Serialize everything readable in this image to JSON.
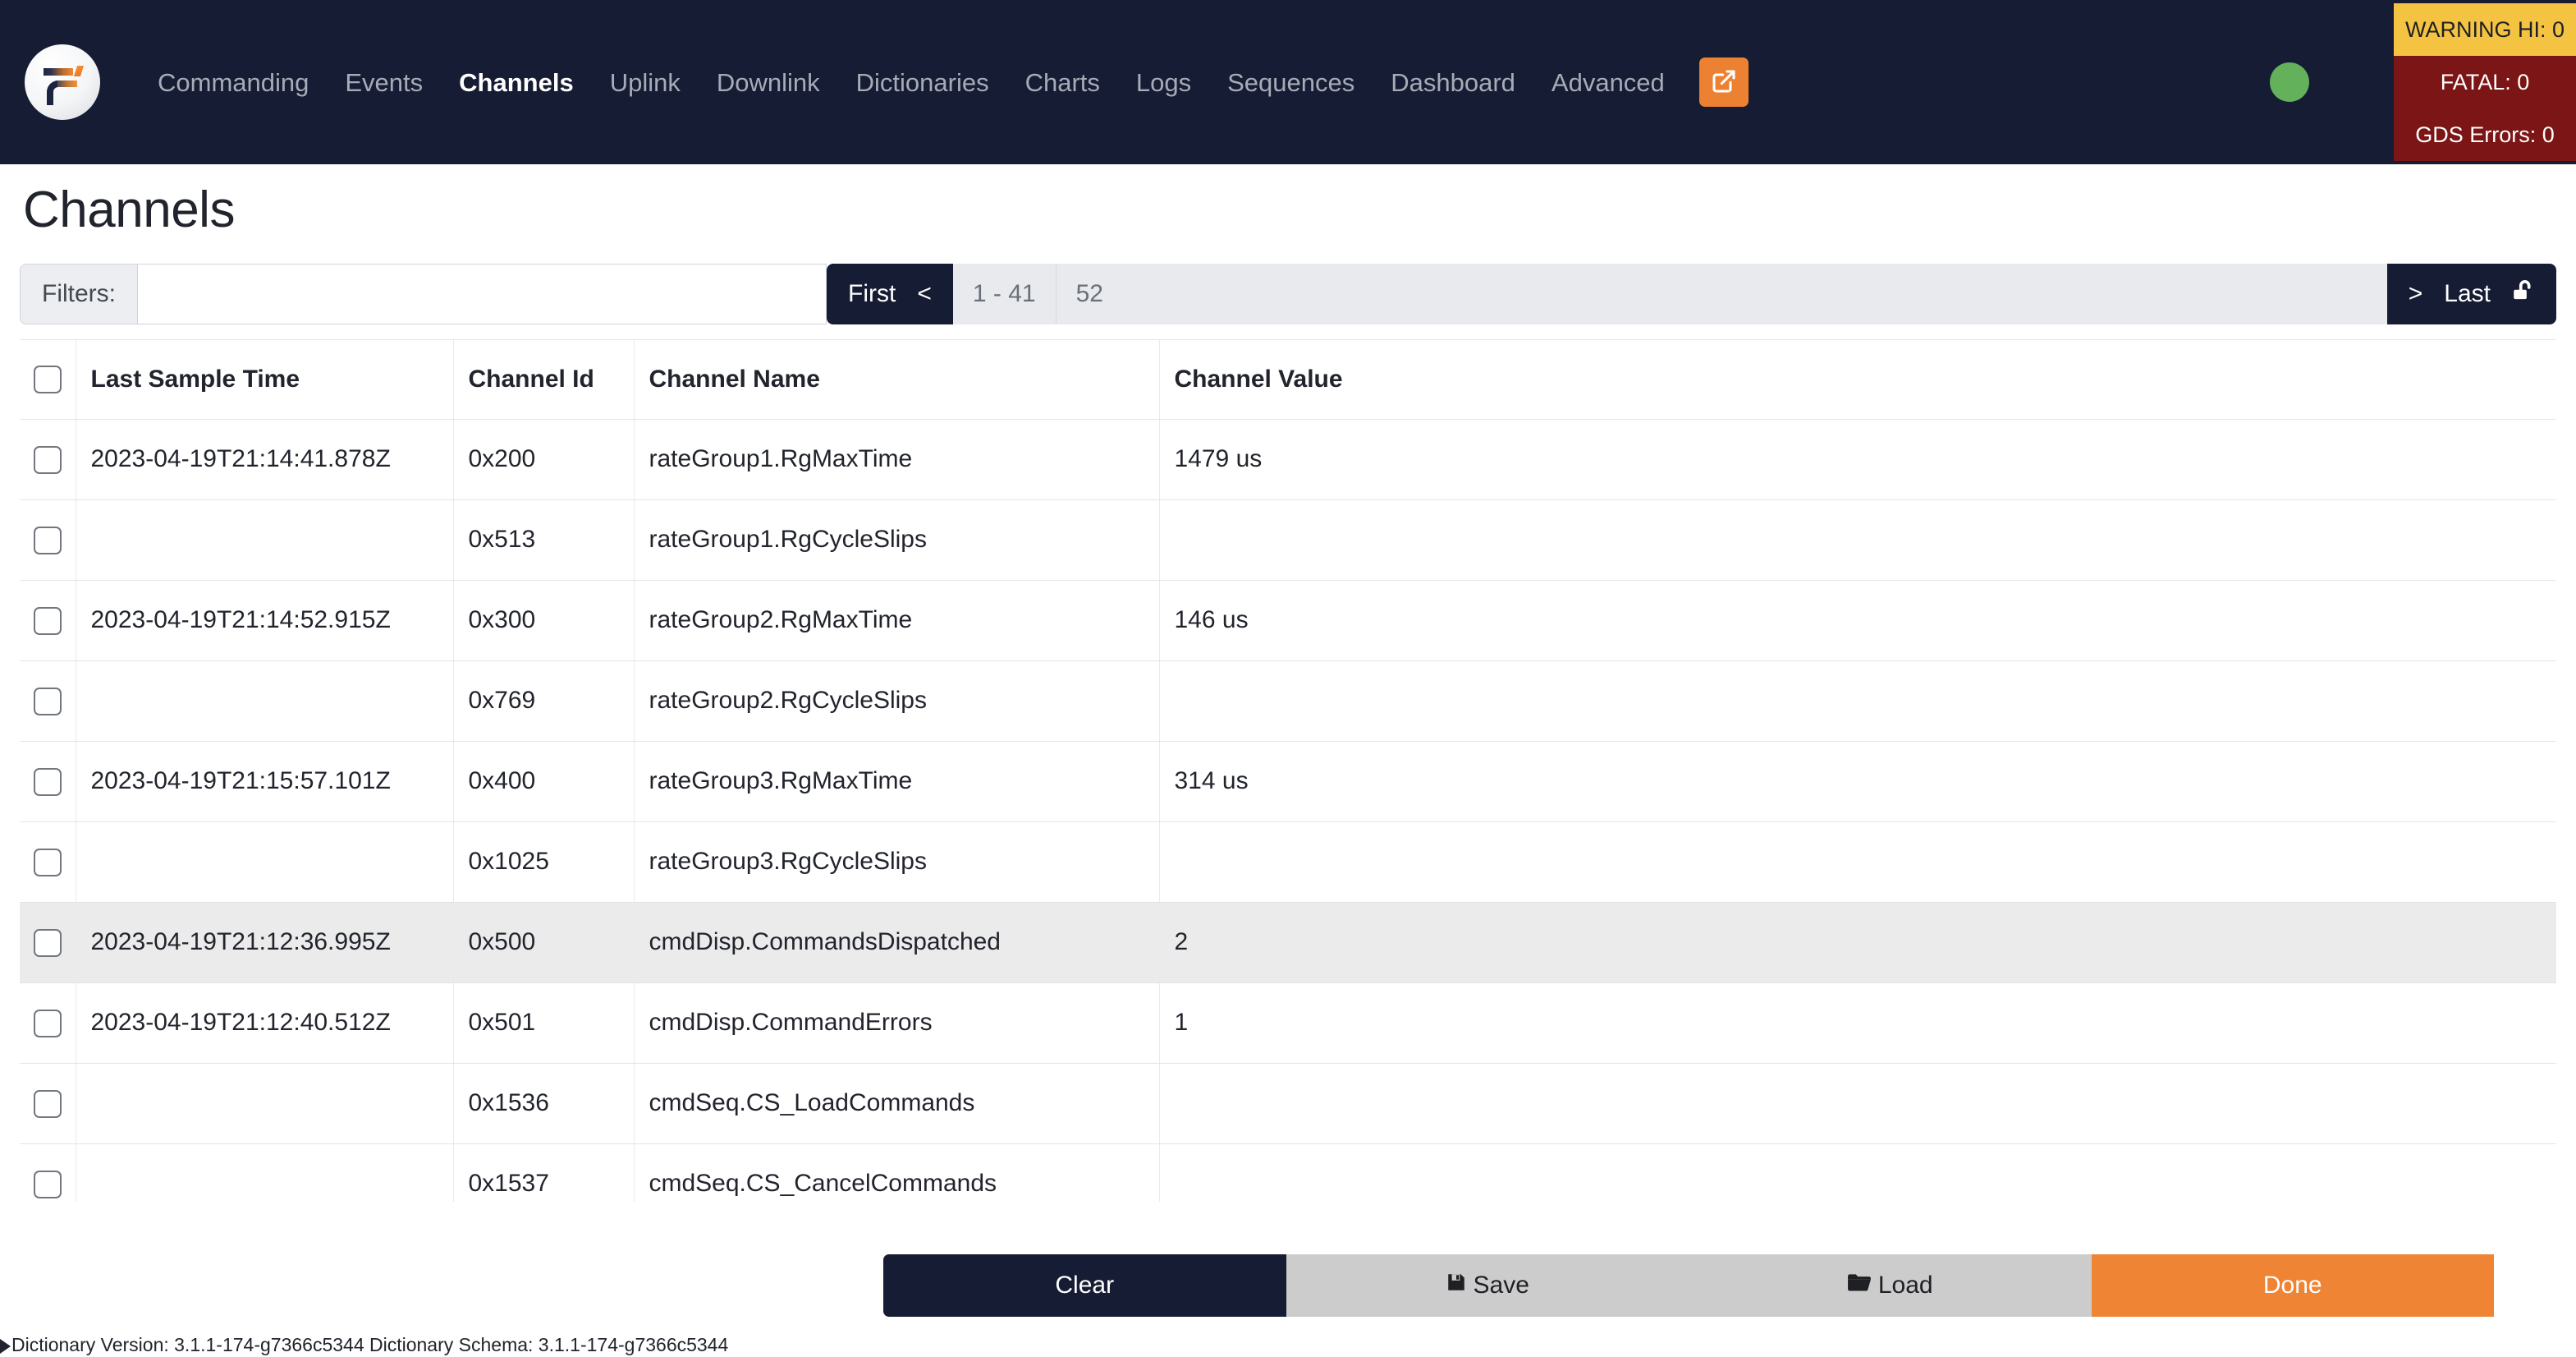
{
  "navbar": {
    "logo_name": "fprime-logo",
    "links": [
      {
        "label": "Commanding",
        "active": false
      },
      {
        "label": "Events",
        "active": false
      },
      {
        "label": "Channels",
        "active": true
      },
      {
        "label": "Uplink",
        "active": false
      },
      {
        "label": "Downlink",
        "active": false
      },
      {
        "label": "Dictionaries",
        "active": false
      },
      {
        "label": "Charts",
        "active": false
      },
      {
        "label": "Logs",
        "active": false
      },
      {
        "label": "Sequences",
        "active": false
      },
      {
        "label": "Dashboard",
        "active": false
      },
      {
        "label": "Advanced",
        "active": false
      }
    ],
    "external_link_icon": "external-link-icon",
    "status_dot_color": "#63b15b",
    "badges": [
      {
        "label": "WARNING HI: 0",
        "bg": "#f5c342",
        "fg": "#1e2024"
      },
      {
        "label": "FATAL: 0",
        "bg": "#7c1616",
        "fg": "#ffffff"
      },
      {
        "label": "GDS Errors: 0",
        "bg": "#7c1616",
        "fg": "#ffffff"
      }
    ]
  },
  "page": {
    "title": "Channels"
  },
  "filter_bar": {
    "filters_label": "Filters:",
    "filter_value": "",
    "filter_placeholder": "",
    "first_label": "First",
    "prev_label": "<",
    "range_label": "1 - 41",
    "total_label": "52",
    "next_label": ">",
    "last_label": "Last",
    "lock_icon": "unlock-icon"
  },
  "table": {
    "headers": [
      "Last Sample Time",
      "Channel Id",
      "Channel Name",
      "Channel Value"
    ],
    "rows": [
      {
        "time": "2023-04-19T21:14:41.878Z",
        "id": "0x200",
        "name": "rateGroup1.RgMaxTime",
        "value": "1479 us",
        "highlight": false
      },
      {
        "time": "",
        "id": "0x513",
        "name": "rateGroup1.RgCycleSlips",
        "value": "",
        "highlight": false
      },
      {
        "time": "2023-04-19T21:14:52.915Z",
        "id": "0x300",
        "name": "rateGroup2.RgMaxTime",
        "value": "146 us",
        "highlight": false
      },
      {
        "time": "",
        "id": "0x769",
        "name": "rateGroup2.RgCycleSlips",
        "value": "",
        "highlight": false
      },
      {
        "time": "2023-04-19T21:15:57.101Z",
        "id": "0x400",
        "name": "rateGroup3.RgMaxTime",
        "value": "314 us",
        "highlight": false
      },
      {
        "time": "",
        "id": "0x1025",
        "name": "rateGroup3.RgCycleSlips",
        "value": "",
        "highlight": false
      },
      {
        "time": "2023-04-19T21:12:36.995Z",
        "id": "0x500",
        "name": "cmdDisp.CommandsDispatched",
        "value": "2",
        "highlight": true
      },
      {
        "time": "2023-04-19T21:12:40.512Z",
        "id": "0x501",
        "name": "cmdDisp.CommandErrors",
        "value": "1",
        "highlight": false
      },
      {
        "time": "",
        "id": "0x1536",
        "name": "cmdSeq.CS_LoadCommands",
        "value": "",
        "highlight": false
      },
      {
        "time": "",
        "id": "0x1537",
        "name": "cmdSeq.CS_CancelCommands",
        "value": "",
        "highlight": false
      },
      {
        "time": "",
        "id": "",
        "name": "",
        "value": "",
        "highlight": false
      }
    ]
  },
  "actions": {
    "clear_label": "Clear",
    "save_label": "Save",
    "save_icon": "save-floppy-icon",
    "load_label": "Load",
    "load_icon": "folder-open-icon",
    "done_label": "Done"
  },
  "footer": {
    "text": "Dictionary Version: 3.1.1-174-g7366c5344 Dictionary Schema: 3.1.1-174-g7366c5344"
  }
}
